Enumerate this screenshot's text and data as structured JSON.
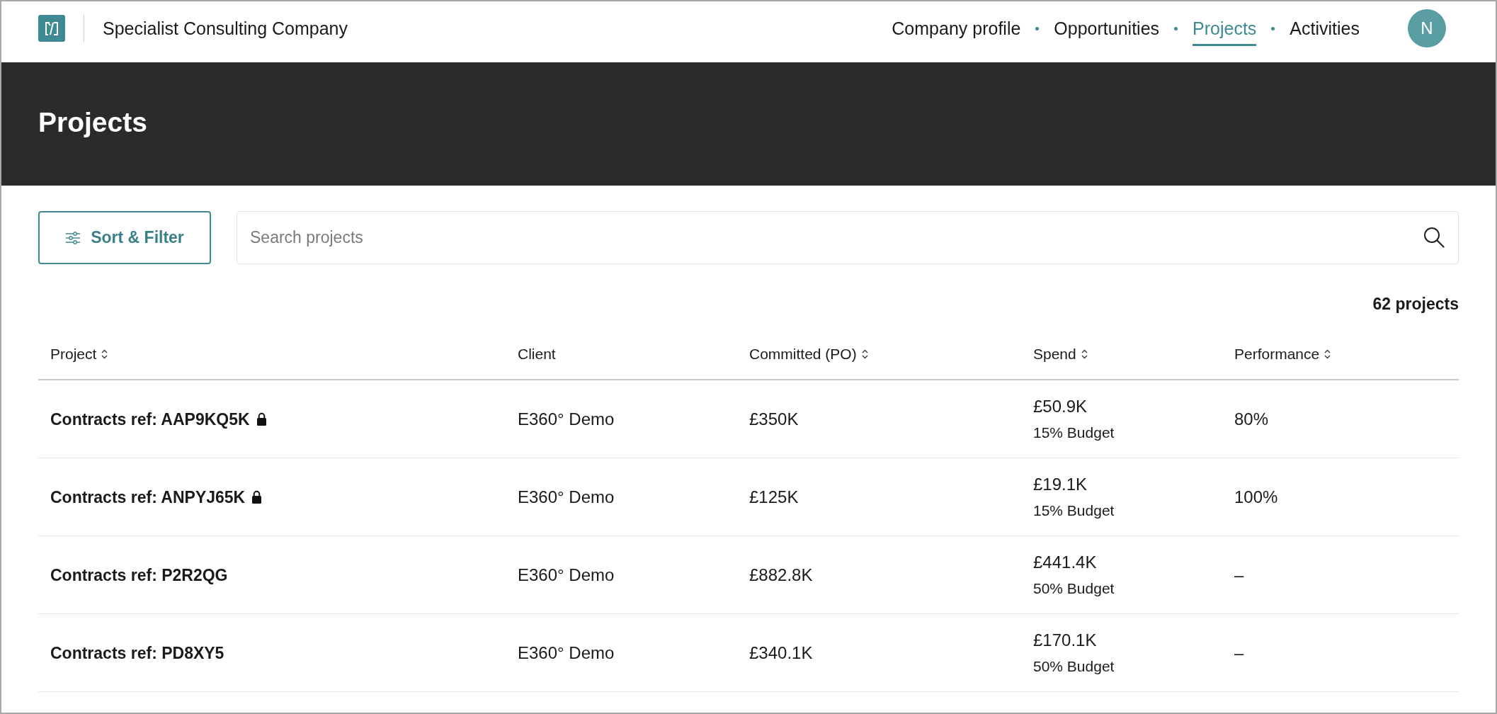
{
  "header": {
    "company_name": "Specialist Consulting Company",
    "nav": [
      {
        "label": "Company profile",
        "selected": false
      },
      {
        "label": "Opportunities",
        "selected": false
      },
      {
        "label": "Projects",
        "selected": true
      },
      {
        "label": "Activities",
        "selected": false
      }
    ],
    "avatar": {
      "initial": "N"
    }
  },
  "banner": {
    "title": "Projects"
  },
  "toolbar": {
    "sort_filter_button": {
      "label": "Sort & Filter"
    },
    "search": {
      "placeholder": "Search projects"
    }
  },
  "result_count": "62 projects",
  "table": {
    "columns": [
      {
        "label": "Project",
        "sortable": true
      },
      {
        "label": "Client",
        "sortable": false
      },
      {
        "label": "Committed (PO)",
        "sortable": true
      },
      {
        "label": "Spend",
        "sortable": true
      },
      {
        "label": "Performance",
        "sortable": true
      }
    ],
    "rows": [
      {
        "project": "Contracts ref: AAP9KQ5K",
        "locked": true,
        "client": "E360° Demo",
        "committed": "£350K",
        "spend": "£50.9K",
        "budget": "15% Budget",
        "performance": "80%"
      },
      {
        "project": "Contracts ref: ANPYJ65K",
        "locked": true,
        "client": "E360° Demo",
        "committed": "£125K",
        "spend": "£19.1K",
        "budget": "15% Budget",
        "performance": "100%"
      },
      {
        "project": "Contracts ref: P2R2QG",
        "locked": false,
        "client": "E360° Demo",
        "committed": "£882.8K",
        "spend": "£441.4K",
        "budget": "50% Budget",
        "performance": "–"
      },
      {
        "project": "Contracts ref: PD8XY5",
        "locked": false,
        "client": "E360° Demo",
        "committed": "£340.1K",
        "spend": "£170.1K",
        "budget": "50% Budget",
        "performance": "–"
      }
    ]
  }
}
